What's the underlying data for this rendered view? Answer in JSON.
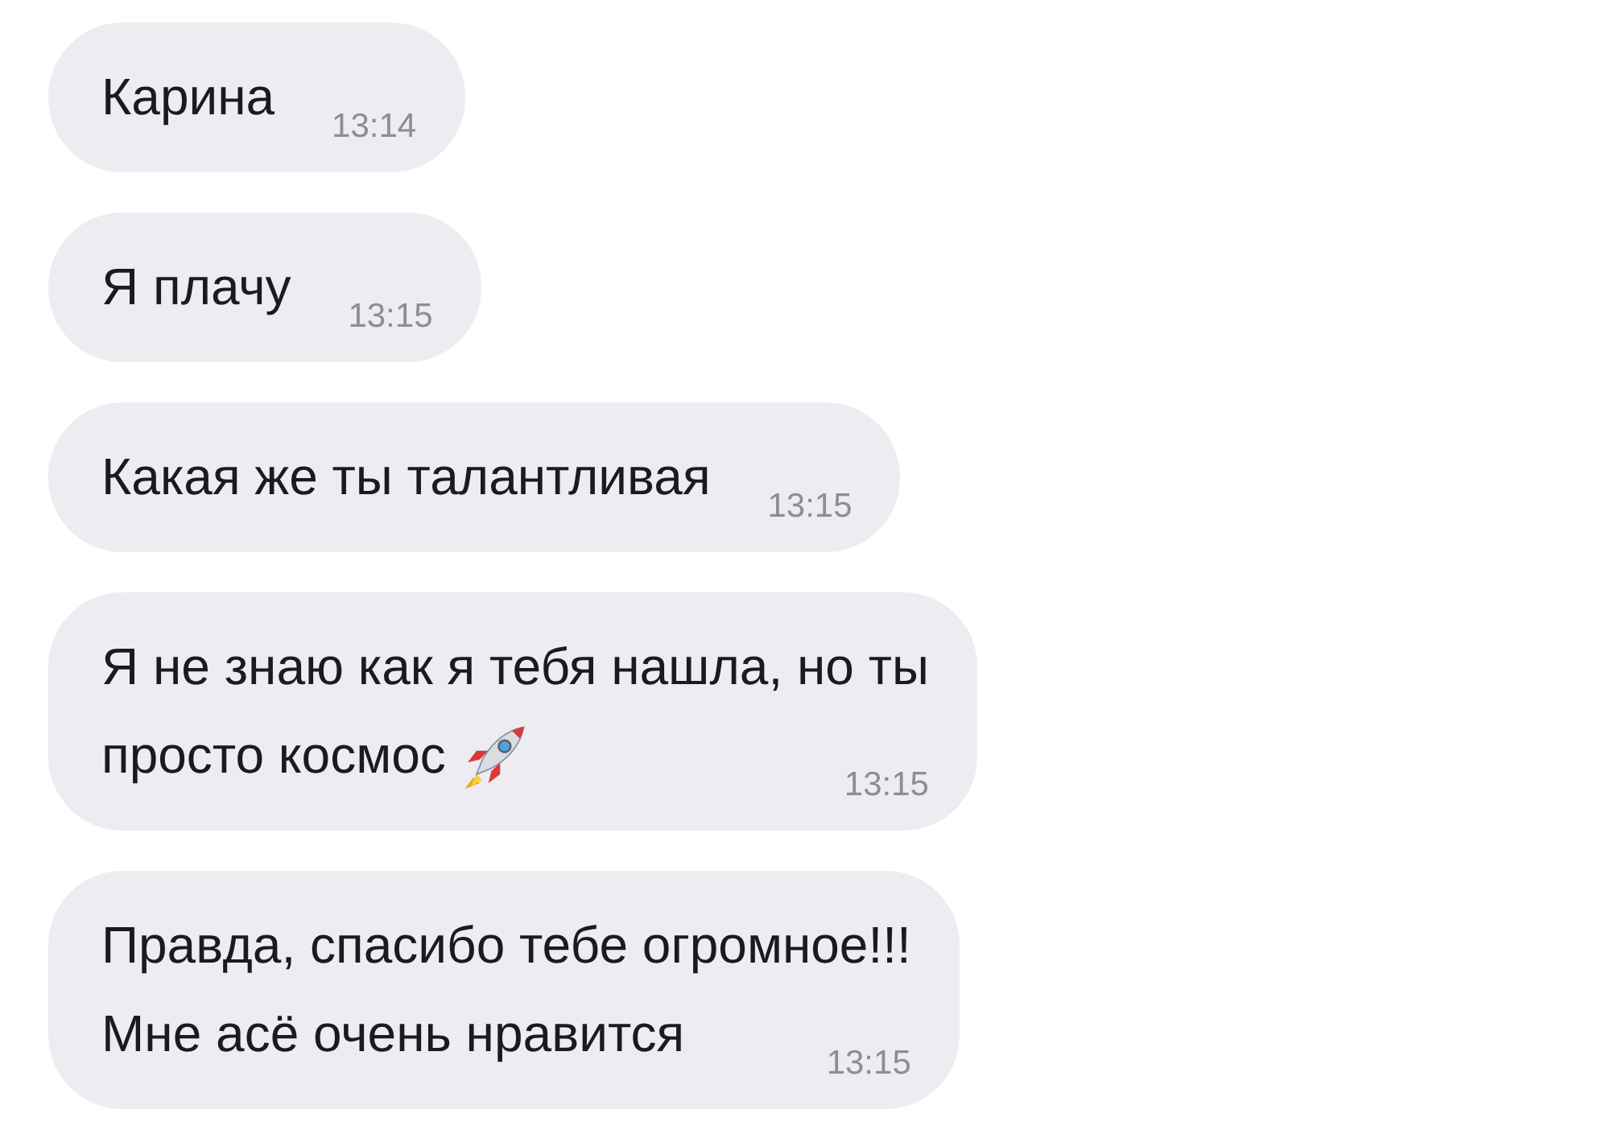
{
  "messages": [
    {
      "kind": "text",
      "lines": [
        "Карина"
      ],
      "time": "13:14"
    },
    {
      "kind": "text",
      "lines": [
        "Я плачу"
      ],
      "time": "13:15"
    },
    {
      "kind": "text",
      "lines": [
        "Какая же ты талантливая"
      ],
      "time": "13:15"
    },
    {
      "kind": "text_with_rocket",
      "lines": [
        "Я не знаю как я тебя нашла, но ты",
        "просто космос"
      ],
      "time": "13:15"
    },
    {
      "kind": "text",
      "lines": [
        "Правда, спасибо тебе огромное!!!",
        "Мне асё очень нравится"
      ],
      "time": "13:15"
    }
  ]
}
